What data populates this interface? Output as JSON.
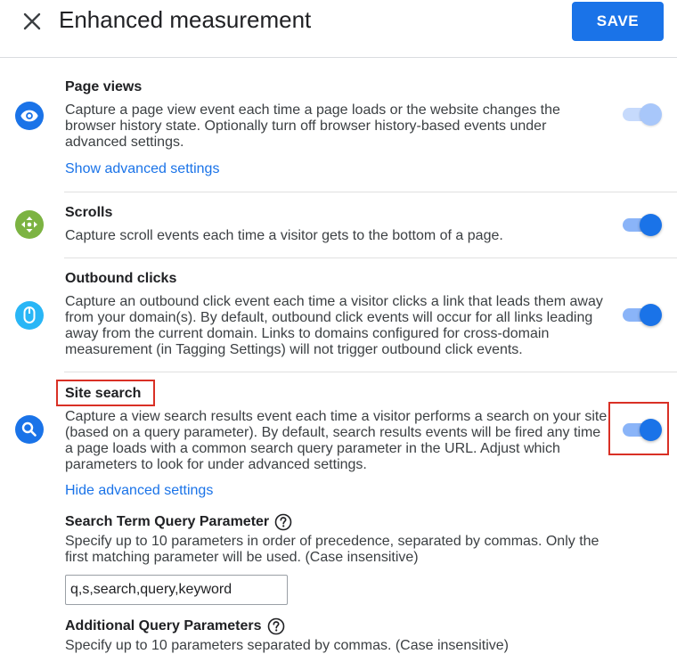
{
  "header": {
    "title": "Enhanced measurement",
    "save_label": "SAVE"
  },
  "sections": [
    {
      "id": "page-views",
      "title": "Page views",
      "description": "Capture a page view event each time a page loads or the website changes the browser history state. Optionally turn off browser history-based events under advanced settings.",
      "link": "Show advanced settings",
      "icon": "eye-icon",
      "icon_color": "#1a73e8",
      "toggle_state": "on-disabled"
    },
    {
      "id": "scrolls",
      "title": "Scrolls",
      "description": "Capture scroll events each time a visitor gets to the bottom of a page.",
      "icon": "scroll-arrows-icon",
      "icon_color": "#7cb342",
      "toggle_state": "on"
    },
    {
      "id": "outbound-clicks",
      "title": "Outbound clicks",
      "description": "Capture an outbound click event each time a visitor clicks a link that leads them away from your domain(s). By default, outbound click events will occur for all links leading away from the current domain. Links to domains configured for cross-domain measurement (in Tagging Settings) will not trigger outbound click events.",
      "icon": "mouse-icon",
      "icon_color": "#29b6f6",
      "toggle_state": "on"
    },
    {
      "id": "site-search",
      "title": "Site search",
      "description": "Capture a view search results event each time a visitor performs a search on your site (based on a query parameter). By default, search results events will be fired any time a page loads with a common search query parameter in the URL. Adjust which parameters to look for under advanced settings.",
      "link": "Hide advanced settings",
      "icon": "search-icon",
      "icon_color": "#1a73e8",
      "toggle_state": "on"
    }
  ],
  "advanced": {
    "search_term": {
      "title": "Search Term Query Parameter",
      "description": "Specify up to 10 parameters in order of precedence, separated by commas. Only the first matching parameter will be used. (Case insensitive)",
      "value": "q,s,search,query,keyword"
    },
    "additional": {
      "title": "Additional Query Parameters",
      "description": "Specify up to 10 parameters separated by commas. (Case insensitive)"
    }
  },
  "colors": {
    "accent": "#1a73e8",
    "highlight": "#d93025"
  }
}
